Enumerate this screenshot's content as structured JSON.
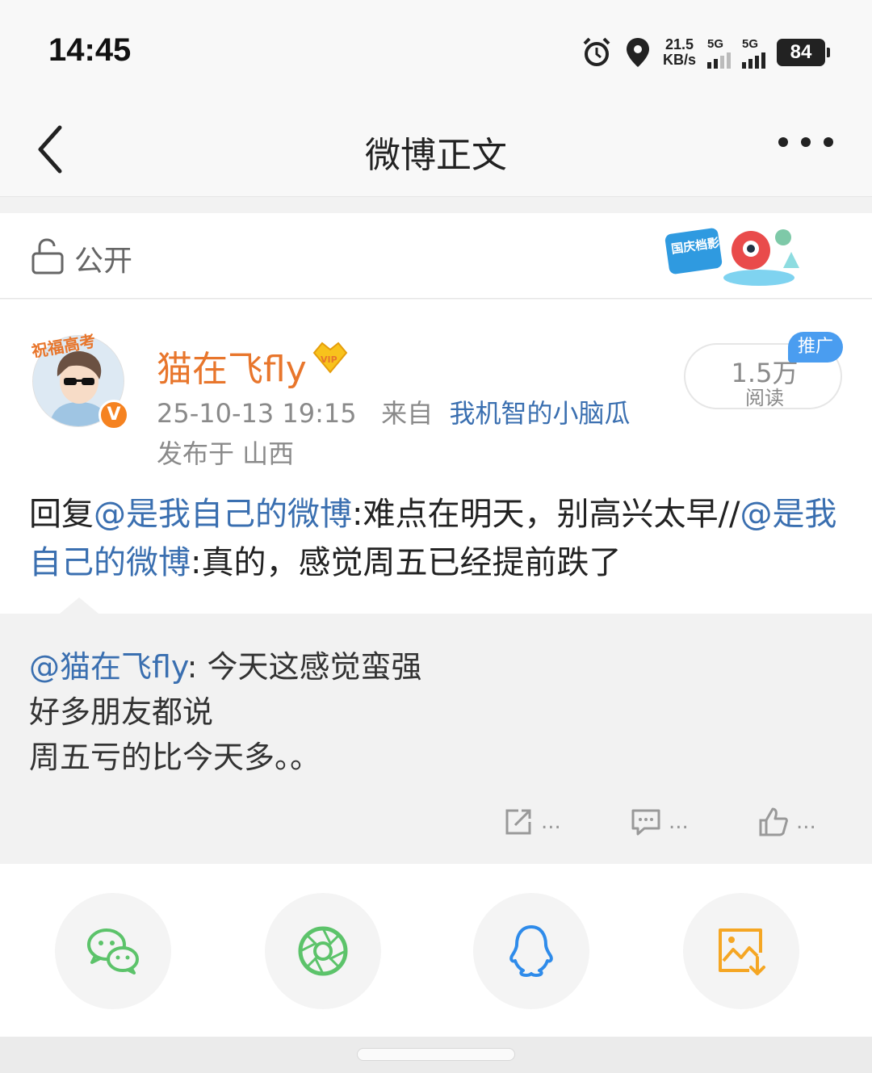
{
  "status_bar": {
    "time": "14:45",
    "speed_value": "21.5",
    "speed_unit": "KB/s",
    "signal1_label": "5G",
    "signal2_label": "5G",
    "battery": "84",
    "icons": [
      "alarm-icon",
      "location-icon"
    ]
  },
  "header": {
    "title": "微博正文",
    "back_icon": "chevron-left-icon",
    "more_icon": "more-dots-icon"
  },
  "visibility": {
    "label": "公开",
    "badge_text": "国庆档影评达人"
  },
  "post": {
    "username": "猫在飞fly",
    "avatar_banner": "祝福高考",
    "timestamp": "25-10-13 19:15",
    "source_prefix": "来自",
    "source": "我机智的小脑瓜",
    "location": "发布于 山西",
    "reads": "1.5万",
    "reads_label": "阅读",
    "promo_label": "推广",
    "text": {
      "reply_prefix": "回复",
      "mention1": "@是我自己的微博",
      "part1": ":难点在明天，别高兴太早//",
      "mention2": "@是我自己的微博",
      "part2": ":真的，感觉周五已经提前跌了"
    }
  },
  "quoted": {
    "mention": "@猫在飞fly",
    "line1": ": 今天这感觉蛮强",
    "line2": "好多朋友都说",
    "line3": "周五亏的比今天多。。",
    "repost_count": "...",
    "comment_count": "...",
    "like_count": "..."
  },
  "share": {
    "targets": [
      "wechat-icon",
      "moments-icon",
      "qq-icon",
      "save-image-icon"
    ]
  },
  "colors": {
    "username": "#e8762c",
    "link": "#3a6fb0",
    "wechat": "#5cc36a",
    "qq": "#2e8bea",
    "save": "#f5a623"
  }
}
